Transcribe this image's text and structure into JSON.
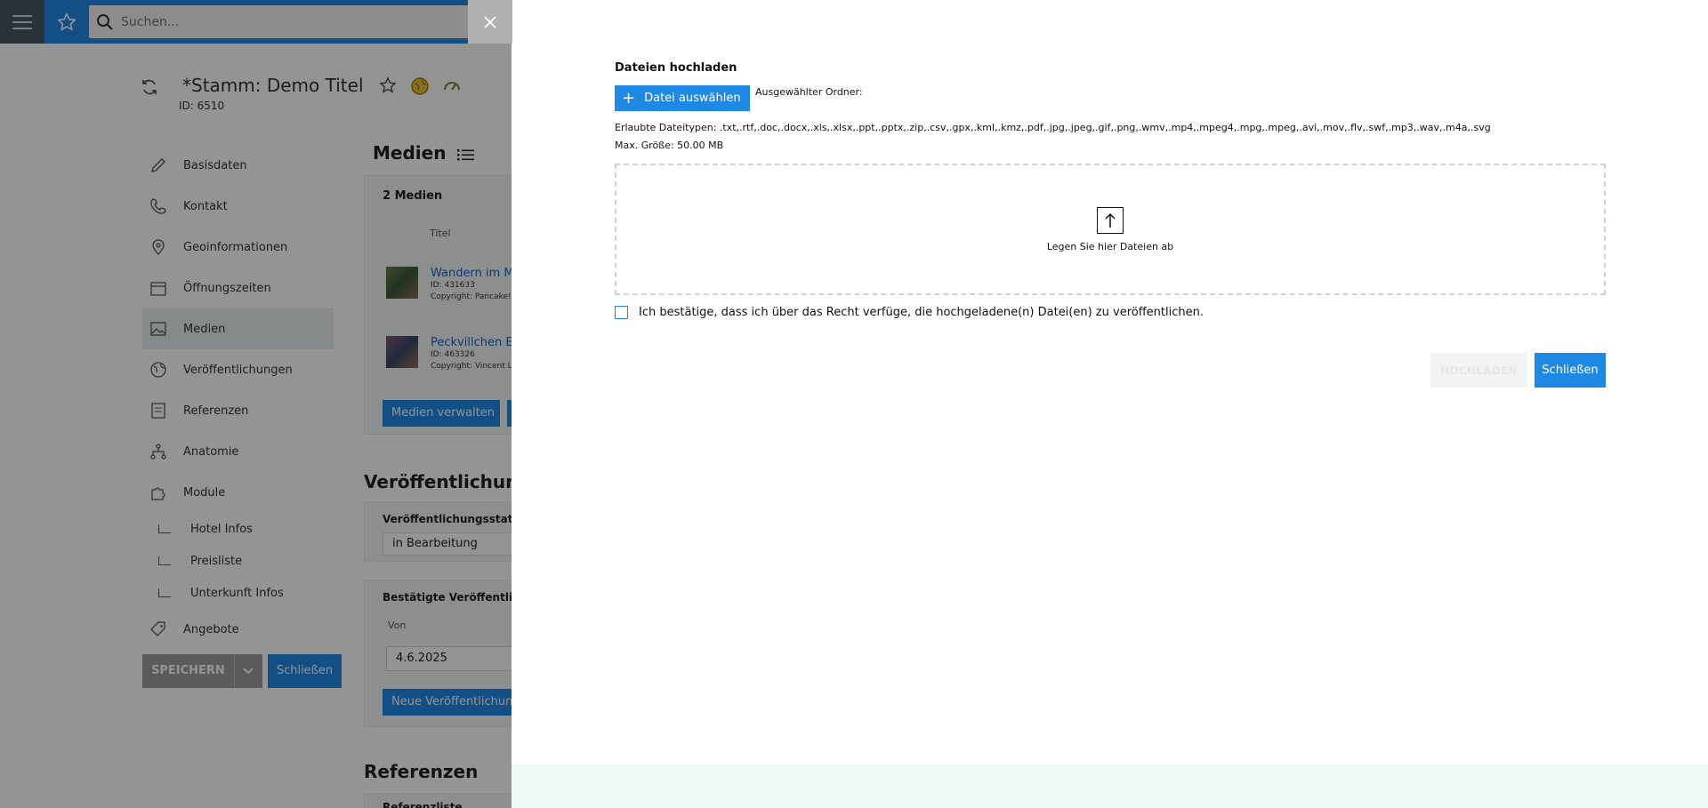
{
  "topbar": {
    "search_placeholder": "Suchen..."
  },
  "record": {
    "title_prefix": "*",
    "title": "Stamm: Demo Titel",
    "id_text": "ID: 6510"
  },
  "sidebar": {
    "items": [
      {
        "label": "Basisdaten",
        "icon": "pencil-icon"
      },
      {
        "label": "Kontakt",
        "icon": "phone-icon"
      },
      {
        "label": "Geoinformationen",
        "icon": "map-pin-icon"
      },
      {
        "label": "Öffnungszeiten",
        "icon": "calendar-icon"
      },
      {
        "label": "Medien",
        "icon": "image-icon",
        "active": true
      },
      {
        "label": "Veröffentlichungen",
        "icon": "globe-icon"
      },
      {
        "label": "Referenzen",
        "icon": "list-icon"
      },
      {
        "label": "Anatomie",
        "icon": "hierarchy-icon"
      },
      {
        "label": "Module",
        "icon": "puzzle-icon"
      }
    ],
    "subitems": [
      "Hotel Infos",
      "Preisliste",
      "Unterkunft Infos"
    ],
    "last_item": {
      "label": "Angebote",
      "icon": "tag-icon"
    },
    "save_label": "SPEICHERN",
    "close_label": "Schließen"
  },
  "media": {
    "section_title": "Medien",
    "count_label": "2 Medien",
    "column_title": "Titel",
    "rows": [
      {
        "title": "Wandern im Mü",
        "id": "ID: 431633",
        "copyright": "Copyright: Pancake!"
      },
      {
        "title": "Peckvillchen Em",
        "id": "ID: 463326",
        "copyright": "Copyright: Vincent Le"
      }
    ],
    "manage_label": "Medien verwalten"
  },
  "publications": {
    "section_title": "Veröffentlichunge",
    "status_label": "Veröffentlichungsstatus",
    "status_value": "in Bearbeitung",
    "confirmed_label": "Bestätigte Veröffentlic",
    "from_label": "Von",
    "from_value": "4.6.2025",
    "new_label": "Neue Veröffentlichung"
  },
  "references": {
    "section_title": "Referenzen",
    "sub_label": "Referenzliste"
  },
  "modal": {
    "title": "Dateien hochladen",
    "choose_label": "Datei auswählen",
    "folder_label": "Ausgewählter Ordner:",
    "allowed_types": "Erlaubte Dateitypen: .txt,.rtf,.doc,.docx,.xls,.xlsx,.ppt,.pptx,.zip,.csv,.gpx,.kml,.kmz,.pdf,.jpg,.jpeg,.gif,.png,.wmv,.mp4,.mpeg4,.mpg,.mpeg,.avi,.mov,.flv,.swf,.mp3,.wav,.m4a,.svg",
    "max_size": "Max. Größe: 50.00 MB",
    "drop_text": "Legen Sie hier Dateien ab",
    "confirm_text": "Ich bestätige, dass ich über das Recht verfüge, die hochgeladene(n) Datei(en) zu veröffentlichen.",
    "upload_label": "HOCHLADEN",
    "close_label": "Schließen"
  },
  "colors": {
    "accent": "#1e88e5",
    "menu": "#455a64",
    "footer_band": "#eef8f7"
  }
}
